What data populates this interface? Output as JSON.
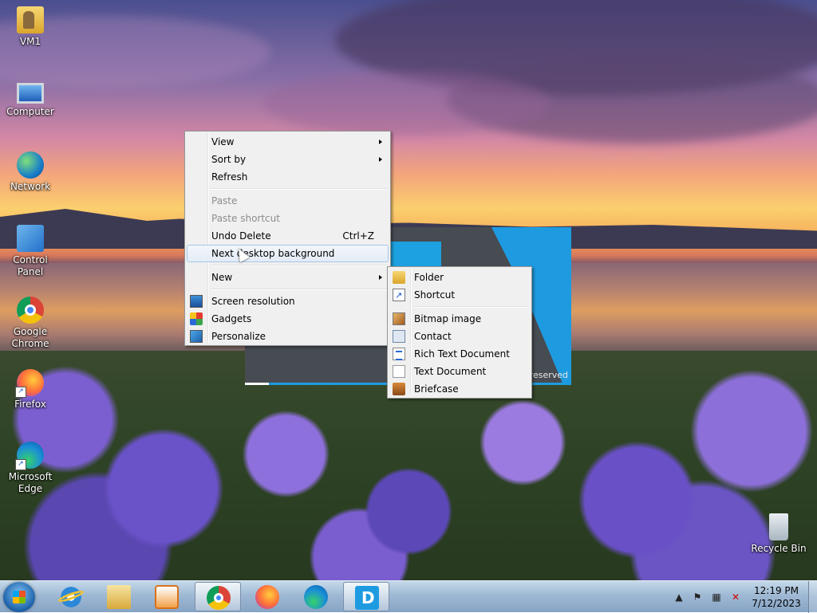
{
  "desktop": {
    "icons": [
      {
        "label": "VM1",
        "icon": "user-folder-icon"
      },
      {
        "label": "Computer",
        "icon": "computer-icon"
      },
      {
        "label": "Network",
        "icon": "network-icon"
      },
      {
        "label": "Control Panel",
        "icon": "control-panel-icon"
      },
      {
        "label": "Google Chrome",
        "icon": "chrome-icon"
      },
      {
        "label": "Firefox",
        "icon": "firefox-icon"
      },
      {
        "label": "Microsoft Edge",
        "icon": "edge-icon"
      },
      {
        "label": "Recycle Bin",
        "icon": "recycle-bin-icon"
      }
    ]
  },
  "background_window": {
    "footer_text": "s reserved",
    "accent_color": "#1e9be0"
  },
  "context_menu": {
    "view": "View",
    "sort_by": "Sort by",
    "refresh": "Refresh",
    "paste": "Paste",
    "paste_shortcut": "Paste shortcut",
    "undo_delete": "Undo Delete",
    "undo_delete_shortcut": "Ctrl+Z",
    "next_desktop_background": "Next desktop background",
    "new": "New",
    "screen_resolution": "Screen resolution",
    "gadgets": "Gadgets",
    "personalize": "Personalize"
  },
  "new_submenu": {
    "folder": "Folder",
    "shortcut": "Shortcut",
    "bitmap_image": "Bitmap image",
    "contact": "Contact",
    "rich_text_document": "Rich Text Document",
    "text_document": "Text Document",
    "briefcase": "Briefcase"
  },
  "taskbar": {
    "pinned": [
      "start-orb",
      "internet-explorer-icon",
      "file-explorer-icon",
      "media-player-icon",
      "chrome-icon",
      "firefox-icon",
      "edge-icon",
      "app-icon"
    ],
    "clock_time": "12:19 PM",
    "clock_date": "7/12/2023",
    "tray_chevron": "▲"
  }
}
